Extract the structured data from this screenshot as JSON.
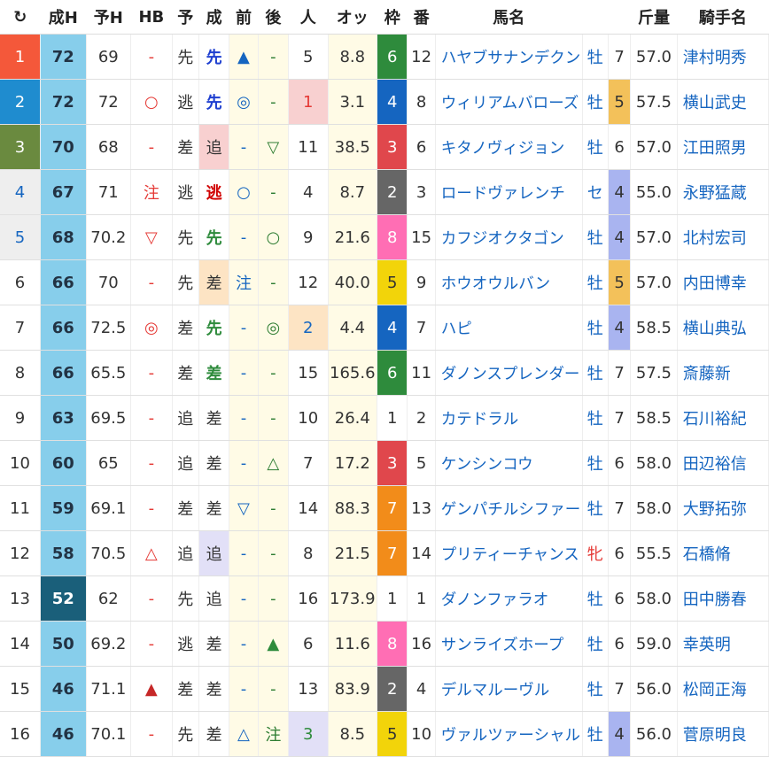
{
  "headers": {
    "reload": "↻",
    "seiH": "成H",
    "yoH": "予H",
    "hb": "HB",
    "yo": "予",
    "sei": "成",
    "mae": "前",
    "ato": "後",
    "ninki": "人",
    "odds": "オッ",
    "waku": "枠",
    "ban": "番",
    "name": "馬名",
    "sex": "",
    "age": "",
    "kinryo": "斤量",
    "jockey": "騎手名"
  },
  "colors": {
    "rank1": "#f4583a",
    "rank2": "#1f8ccf",
    "rank3": "#6a8a3f",
    "rank45": "#eeeeee",
    "seiH_default": "#87ceeb",
    "seiH_13": "#1a5f7a",
    "ninki_1": "#f8d0d0",
    "ninki_2": "#fde4c4",
    "ninki_3": "#e2e0f7",
    "waku1": "#ffffff",
    "waku2": "#666666",
    "waku3": "#e0474c",
    "waku4": "#1565c0",
    "waku5": "#f2d40a",
    "waku6": "#2e8b3c",
    "waku7": "#f28c1a",
    "waku8": "#ff6eb4",
    "age4": "#a9b4f0",
    "age5": "#f3c15a"
  },
  "rows": [
    {
      "rank": "1",
      "seiH": "72",
      "yoH": "69",
      "hb": "-",
      "yo": "先",
      "sei": "先",
      "mae": "▲",
      "ato": "-",
      "ninki": "5",
      "odds": "8.8",
      "waku": "6",
      "ban": "12",
      "name": "ハヤブサナンデクン",
      "sex": "牡",
      "age": "7",
      "kinryo": "57.0",
      "jockey": "津村明秀"
    },
    {
      "rank": "2",
      "seiH": "72",
      "yoH": "72",
      "hb": "○",
      "yo": "逃",
      "sei": "先",
      "mae": "◎",
      "ato": "-",
      "ninki": "1",
      "odds": "3.1",
      "waku": "4",
      "ban": "8",
      "name": "ウィリアムバローズ",
      "sex": "牡",
      "age": "5",
      "kinryo": "57.5",
      "jockey": "横山武史"
    },
    {
      "rank": "3",
      "seiH": "70",
      "yoH": "68",
      "hb": "-",
      "yo": "差",
      "sei": "追",
      "mae": "-",
      "ato": "▽",
      "ninki": "11",
      "odds": "38.5",
      "waku": "3",
      "ban": "6",
      "name": "キタノヴィジョン",
      "sex": "牡",
      "age": "6",
      "kinryo": "57.0",
      "jockey": "江田照男"
    },
    {
      "rank": "4",
      "seiH": "67",
      "yoH": "71",
      "hb": "注",
      "yo": "逃",
      "sei": "逃",
      "mae": "○",
      "ato": "-",
      "ninki": "4",
      "odds": "8.7",
      "waku": "2",
      "ban": "3",
      "name": "ロードヴァレンチ",
      "sex": "セ",
      "age": "4",
      "kinryo": "55.0",
      "jockey": "永野猛蔵"
    },
    {
      "rank": "5",
      "seiH": "68",
      "yoH": "70.2",
      "hb": "▽",
      "yo": "先",
      "sei": "先",
      "mae": "-",
      "ato": "○",
      "ninki": "9",
      "odds": "21.6",
      "waku": "8",
      "ban": "15",
      "name": "カフジオクタゴン",
      "sex": "牡",
      "age": "4",
      "kinryo": "57.0",
      "jockey": "北村宏司"
    },
    {
      "rank": "6",
      "seiH": "66",
      "yoH": "70",
      "hb": "-",
      "yo": "先",
      "sei": "差",
      "mae": "注",
      "ato": "-",
      "ninki": "12",
      "odds": "40.0",
      "waku": "5",
      "ban": "9",
      "name": "ホウオウルバン",
      "sex": "牡",
      "age": "5",
      "kinryo": "57.0",
      "jockey": "内田博幸"
    },
    {
      "rank": "7",
      "seiH": "66",
      "yoH": "72.5",
      "hb": "◎",
      "yo": "差",
      "sei": "先",
      "mae": "-",
      "ato": "◎",
      "ninki": "2",
      "odds": "4.4",
      "waku": "4",
      "ban": "7",
      "name": "ハピ",
      "sex": "牡",
      "age": "4",
      "kinryo": "58.5",
      "jockey": "横山典弘"
    },
    {
      "rank": "8",
      "seiH": "66",
      "yoH": "65.5",
      "hb": "-",
      "yo": "差",
      "sei": "差",
      "mae": "-",
      "ato": "-",
      "ninki": "15",
      "odds": "165.6",
      "waku": "6",
      "ban": "11",
      "name": "ダノンスプレンダー",
      "sex": "牡",
      "age": "7",
      "kinryo": "57.5",
      "jockey": "斎藤新"
    },
    {
      "rank": "9",
      "seiH": "63",
      "yoH": "69.5",
      "hb": "-",
      "yo": "追",
      "sei": "差",
      "mae": "-",
      "ato": "-",
      "ninki": "10",
      "odds": "26.4",
      "waku": "1",
      "ban": "2",
      "name": "カテドラル",
      "sex": "牡",
      "age": "7",
      "kinryo": "58.5",
      "jockey": "石川裕紀"
    },
    {
      "rank": "10",
      "seiH": "60",
      "yoH": "65",
      "hb": "-",
      "yo": "追",
      "sei": "差",
      "mae": "-",
      "ato": "△",
      "ninki": "7",
      "odds": "17.2",
      "waku": "3",
      "ban": "5",
      "name": "ケンシンコウ",
      "sex": "牡",
      "age": "6",
      "kinryo": "58.0",
      "jockey": "田辺裕信"
    },
    {
      "rank": "11",
      "seiH": "59",
      "yoH": "69.1",
      "hb": "-",
      "yo": "差",
      "sei": "差",
      "mae": "▽",
      "ato": "-",
      "ninki": "14",
      "odds": "88.3",
      "waku": "7",
      "ban": "13",
      "name": "ゲンパチルシファー",
      "sex": "牡",
      "age": "7",
      "kinryo": "58.0",
      "jockey": "大野拓弥"
    },
    {
      "rank": "12",
      "seiH": "58",
      "yoH": "70.5",
      "hb": "△",
      "yo": "追",
      "sei": "追",
      "mae": "-",
      "ato": "-",
      "ninki": "8",
      "odds": "21.5",
      "waku": "7",
      "ban": "14",
      "name": "プリティーチャンス",
      "sex": "牝",
      "age": "6",
      "kinryo": "55.5",
      "jockey": "石橋脩"
    },
    {
      "rank": "13",
      "seiH": "52",
      "yoH": "62",
      "hb": "-",
      "yo": "先",
      "sei": "追",
      "mae": "-",
      "ato": "-",
      "ninki": "16",
      "odds": "173.9",
      "waku": "1",
      "ban": "1",
      "name": "ダノンファラオ",
      "sex": "牡",
      "age": "6",
      "kinryo": "58.0",
      "jockey": "田中勝春"
    },
    {
      "rank": "14",
      "seiH": "50",
      "yoH": "69.2",
      "hb": "-",
      "yo": "逃",
      "sei": "差",
      "mae": "-",
      "ato": "▲",
      "ninki": "6",
      "odds": "11.6",
      "waku": "8",
      "ban": "16",
      "name": "サンライズホープ",
      "sex": "牡",
      "age": "6",
      "kinryo": "59.0",
      "jockey": "幸英明"
    },
    {
      "rank": "15",
      "seiH": "46",
      "yoH": "71.1",
      "hb": "▲",
      "yo": "差",
      "sei": "差",
      "mae": "-",
      "ato": "-",
      "ninki": "13",
      "odds": "83.9",
      "waku": "2",
      "ban": "4",
      "name": "デルマルーヴル",
      "sex": "牡",
      "age": "7",
      "kinryo": "56.0",
      "jockey": "松岡正海"
    },
    {
      "rank": "16",
      "seiH": "46",
      "yoH": "70.1",
      "hb": "-",
      "yo": "先",
      "sei": "差",
      "mae": "△",
      "ato": "注",
      "ninki": "3",
      "odds": "8.5",
      "waku": "5",
      "ban": "10",
      "name": "ヴァルツァーシャル",
      "sex": "牡",
      "age": "4",
      "kinryo": "56.0",
      "jockey": "菅原明良"
    }
  ]
}
